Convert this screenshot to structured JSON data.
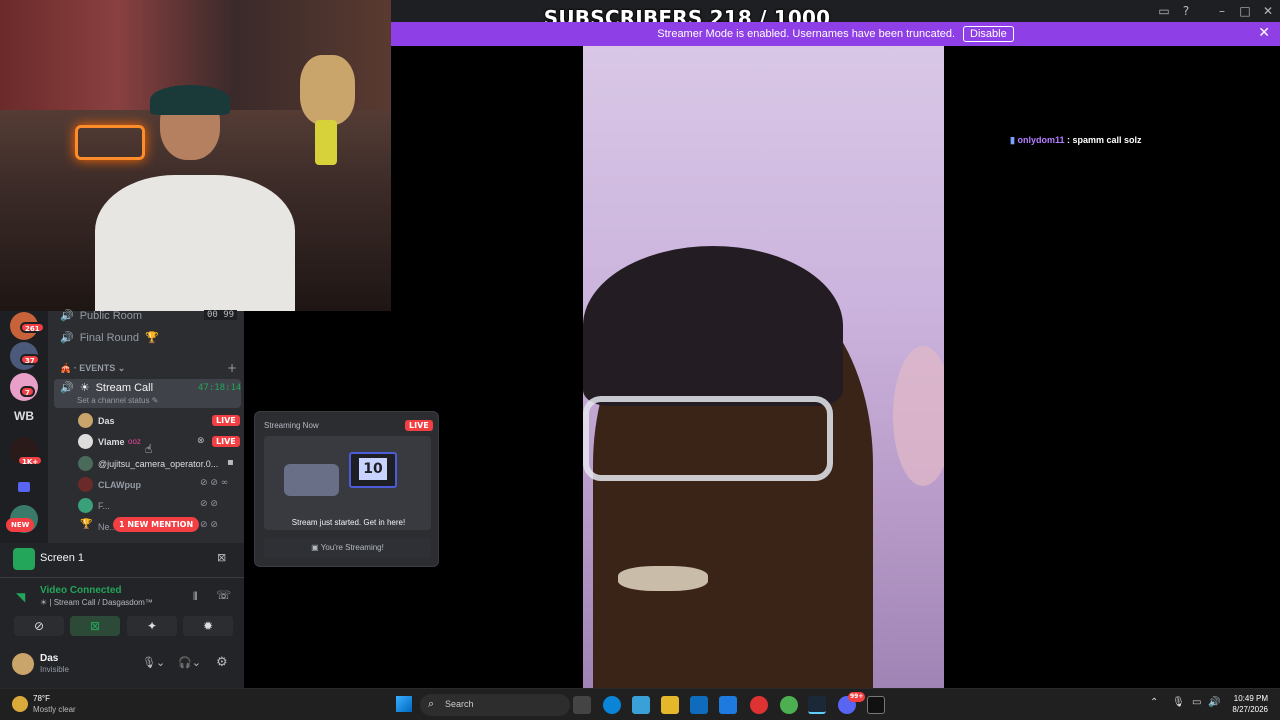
{
  "overlay": {
    "subscribers": "SUBSCRIBERS 218 / 1000"
  },
  "streamer_bar": {
    "message": "Streamer Mode is enabled. Usernames have been truncated.",
    "disable_label": "Disable"
  },
  "chat": {
    "user": "onlydom11",
    "message": ": spamm call solz"
  },
  "guild_badges": [
    "261",
    "37",
    "7",
    "1K+"
  ],
  "guild_wb": "WB",
  "guild_new": "NEW",
  "channels": {
    "public_room": "Public Room",
    "public_counts": [
      "00",
      "99"
    ],
    "final_round": "Final Round",
    "events_label": "EVENTS",
    "stream_call": "Stream Call",
    "stream_timer": "47:18:14",
    "set_status": "Set a channel status"
  },
  "members": [
    {
      "name": "Das",
      "live": "LIVE"
    },
    {
      "name": "Vlame",
      "extra": "ooz",
      "live": "LIVE"
    },
    {
      "name": "@jujitsu_camera_operator.0..."
    },
    {
      "name": "CLAWpup"
    },
    {
      "name": "F..."
    },
    {
      "name": "Ne..."
    }
  ],
  "mention_pill": "1 NEW MENTION",
  "popup": {
    "title": "Streaming Now",
    "live": "LIVE",
    "screen_number": "10",
    "body": "Stream just started. Get in here!",
    "button": "You're Streaming!"
  },
  "screen_share": {
    "label": "Screen 1"
  },
  "voice": {
    "status": "Video Connected",
    "channel": "Stream Call / Dasgasdom™"
  },
  "user": {
    "name": "Das",
    "status": "Invisible"
  },
  "taskbar": {
    "temp": "78°F",
    "weather": "Mostly clear",
    "search_placeholder": "Search",
    "time": "10:49 PM",
    "date": "8/27/2026",
    "steam_badge": "99+"
  },
  "colors": {
    "streamer_bar": "#8f3fe6",
    "live": "#f23f43",
    "connected": "#23a55a",
    "discord_bg": "#2b2d31"
  }
}
